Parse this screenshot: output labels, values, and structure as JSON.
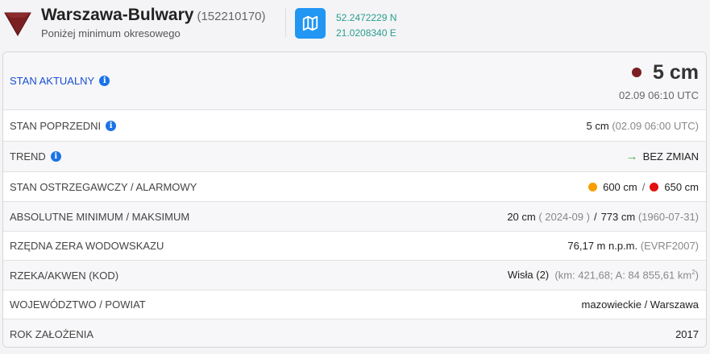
{
  "header": {
    "station_name": "Warszawa-Bulwary",
    "station_code": "(152210170)",
    "subtitle": "Poniżej minimum okresowego",
    "lat": "52.2472229 N",
    "lon": "21.0208340 E",
    "icons": {
      "status": "triangle-down-icon",
      "map": "map-icon"
    },
    "colors": {
      "status": "#7a1f22",
      "map_button": "#2196f3",
      "coords": "#2a9d8f"
    }
  },
  "current": {
    "label": "STAN AKTUALNY",
    "value": "5 cm",
    "datetime": "02.09 06:10 UTC",
    "dot_color": "#7a1f22"
  },
  "previous": {
    "label": "STAN POPRZEDNI",
    "value": "5 cm",
    "time": "(02.09 06:00 UTC)"
  },
  "trend": {
    "label": "TREND",
    "value": "BEZ ZMIAN",
    "arrow": "→"
  },
  "warning": {
    "label": "STAN OSTRZEGAWCZY / ALARMOWY",
    "warning_value": "600 cm",
    "separator": "/",
    "alarm_value": "650 cm",
    "warning_color": "#f5a000",
    "alarm_color": "#e01010"
  },
  "minmax": {
    "label": "ABSOLUTNE MINIMUM / MAKSIMUM",
    "min_value": "20 cm",
    "min_date": "( 2024-09 )",
    "separator": "/",
    "max_value": "773 cm",
    "max_date": "(1960-07-31)"
  },
  "zero": {
    "label": "RZĘDNA ZERA WODOWSKAZU",
    "value": "76,17 m n.p.m.",
    "datum": "(EVRF2007)"
  },
  "river": {
    "label": "RZEKA/AKWEN (KOD)",
    "value": "Wisła (2)",
    "details": "(km: 421,68; A: 84 855,61 km",
    "sup": "2",
    "details_end": ")"
  },
  "region": {
    "label": "WOJEWÓDZTWO / POWIAT",
    "value": "mazowieckie / Warszawa"
  },
  "founded": {
    "label": "ROK ZAŁOŻENIA",
    "value": "2017"
  },
  "info_icon": "i"
}
